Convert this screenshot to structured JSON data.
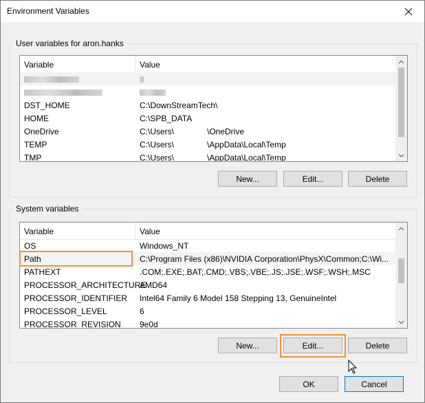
{
  "window": {
    "title": "Environment Variables"
  },
  "user_section": {
    "label": "User variables for aron.hanks",
    "col_variable": "Variable",
    "col_value": "Value",
    "rows": [
      {
        "name": "",
        "value": ""
      },
      {
        "name": "",
        "value": ""
      },
      {
        "name": "DST_HOME",
        "value": "C:\\DownStreamTech\\"
      },
      {
        "name": "HOME",
        "value": "C:\\SPB_DATA"
      },
      {
        "name": "OneDrive",
        "value": "C:\\Users\\    \\OneDrive"
      },
      {
        "name": "TEMP",
        "value": "C:\\Users\\    \\AppData\\Local\\Temp"
      },
      {
        "name": "TMP",
        "value": "C:\\Users\\    \\AppData\\Local\\Temp"
      }
    ],
    "buttons": {
      "new": "New...",
      "edit": "Edit...",
      "delete": "Delete"
    }
  },
  "system_section": {
    "label": "System variables",
    "col_variable": "Variable",
    "col_value": "Value",
    "rows": [
      {
        "name": "OS",
        "value": "Windows_NT"
      },
      {
        "name": "Path",
        "value": "C:\\Program Files (x86)\\NVIDIA Corporation\\PhysX\\Common;C:\\Wi..."
      },
      {
        "name": "PATHEXT",
        "value": ".COM;.EXE;.BAT;.CMD;.VBS;.VBE;.JS;.JSE;.WSF;.WSH;.MSC"
      },
      {
        "name": "PROCESSOR_ARCHITECTURE",
        "value": "AMD64"
      },
      {
        "name": "PROCESSOR_IDENTIFIER",
        "value": "Intel64 Family 6 Model 158 Stepping 13, GenuineIntel"
      },
      {
        "name": "PROCESSOR_LEVEL",
        "value": "6"
      },
      {
        "name": "PROCESSOR_REVISION",
        "value": "9e0d"
      }
    ],
    "buttons": {
      "new": "New...",
      "edit": "Edit...",
      "delete": "Delete"
    }
  },
  "footer": {
    "ok": "OK",
    "cancel": "Cancel"
  },
  "colors": {
    "highlight": "#f0913a",
    "accent": "#0078d7"
  },
  "icons": {
    "close": "close-icon",
    "scroll_up": "chevron-up-icon",
    "scroll_down": "chevron-down-icon",
    "cursor": "mouse-pointer-icon"
  }
}
